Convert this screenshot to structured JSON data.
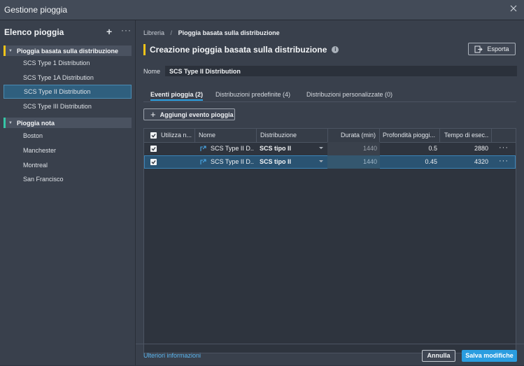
{
  "window": {
    "title": "Gestione pioggia"
  },
  "sidebar": {
    "title": "Elenco pioggia",
    "groups": [
      {
        "label": "Pioggia basata sulla distribuzione",
        "accent": "#f0c419",
        "items": [
          "SCS Type 1 Distribution",
          "SCS Type 1A Distribution",
          "SCS Type II Distribution",
          "SCS Type III Distribution"
        ]
      },
      {
        "label": "Pioggia nota",
        "accent": "#35c6a6",
        "items": [
          "Boston",
          "Manchester",
          "Montreal",
          "San Francisco"
        ]
      }
    ],
    "selected_item": "SCS Type II Distribution"
  },
  "breadcrumb": {
    "root": "Libreria",
    "current": "Pioggia basata sulla distribuzione"
  },
  "page": {
    "title": "Creazione pioggia basata sulla distribuzione",
    "export_label": "Esporta",
    "name_label": "Nome",
    "name_value": "SCS Type II Distribution"
  },
  "tabs": [
    {
      "label": "Eventi pioggia (2)",
      "active": true
    },
    {
      "label": "Distribuzioni predefinite (4)",
      "active": false
    },
    {
      "label": "Distribuzioni personalizzate (0)",
      "active": false
    }
  ],
  "add_button": "Aggiungi evento pioggia",
  "table": {
    "columns": [
      "Utilizza n...",
      "Nome",
      "Distribuzione",
      "Durata (min)",
      "Profondità pioggi...",
      "Tempo di esec..."
    ],
    "rows": [
      {
        "use": true,
        "name": "SCS Type II D...",
        "distribution": "SCS tipo II",
        "duration": "1440",
        "depth": "0.5",
        "time": "2880"
      },
      {
        "use": true,
        "name": "SCS Type II D...",
        "distribution": "SCS tipo II",
        "duration": "1440",
        "depth": "0.45",
        "time": "4320"
      }
    ],
    "selected_row": 1
  },
  "footer": {
    "link": "Ulteriori informazioni",
    "cancel": "Annulla",
    "save": "Salva modifiche"
  },
  "colors": {
    "accent_blue": "#2a9de0",
    "selection": "#2f5f7e",
    "link": "#5cb8f2"
  },
  "icons": [
    "close-icon",
    "plus-icon",
    "more-icon",
    "info-icon",
    "export-icon",
    "edit-icon",
    "checkbox-icon",
    "chevron-down-icon"
  ]
}
